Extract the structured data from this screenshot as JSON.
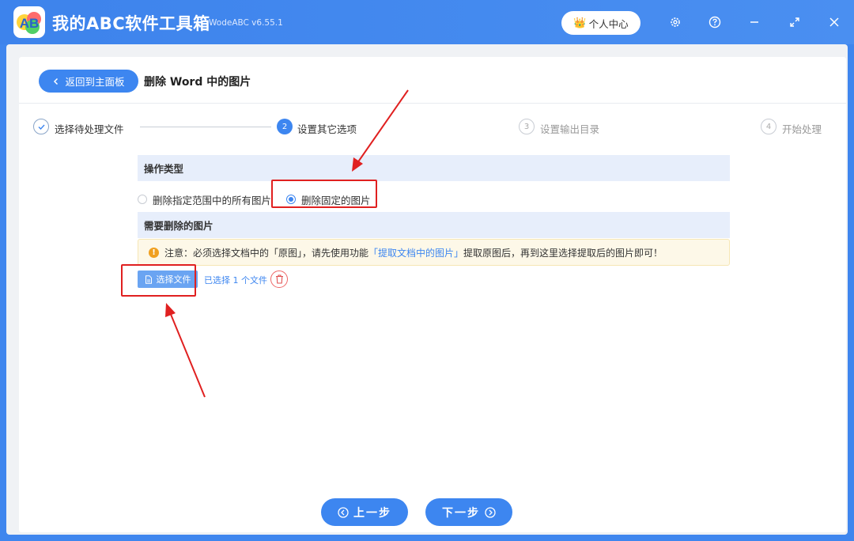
{
  "app": {
    "logo_text": "AB",
    "title": "我的ABC软件工具箱",
    "version": "WodeABC v6.55.1",
    "user_center_label": "个人中心",
    "crown_glyph": "👑"
  },
  "header": {
    "back_label": "返回到主面板",
    "page_title": "删除 Word 中的图片"
  },
  "steps": [
    {
      "number": "✓",
      "label": "选择待处理文件",
      "state": "done"
    },
    {
      "number": "2",
      "label": "设置其它选项",
      "state": "active"
    },
    {
      "number": "3",
      "label": "设置输出目录",
      "state": "pending"
    },
    {
      "number": "4",
      "label": "开始处理",
      "state": "pending"
    }
  ],
  "operation": {
    "heading": "操作类型",
    "options": [
      {
        "label": "删除指定范围中的所有图片",
        "checked": false
      },
      {
        "label": "删除固定的图片",
        "checked": true
      }
    ]
  },
  "images_section": {
    "heading": "需要删除的图片",
    "notice_prefix": "注意：必须选择文档中的「原图」，请先使用功能",
    "notice_link": "「提取文档中的图片」",
    "notice_suffix": "提取原图后，再到这里选择提取后的图片即可！",
    "select_button": "选择文件",
    "selected_text": "已选择 1 个文件"
  },
  "footer": {
    "prev_label": "上一步",
    "next_label": "下一步"
  },
  "colors": {
    "primary": "#3d86f0",
    "annotation": "#e02020",
    "warning": "#f0a020"
  },
  "icons": [
    "chevron-left-icon",
    "gear-icon",
    "help-icon",
    "minimize-icon",
    "maximize-icon",
    "close-icon",
    "file-icon",
    "trash-icon",
    "warning-icon",
    "arrow-left-circle-icon",
    "arrow-right-circle-icon"
  ]
}
